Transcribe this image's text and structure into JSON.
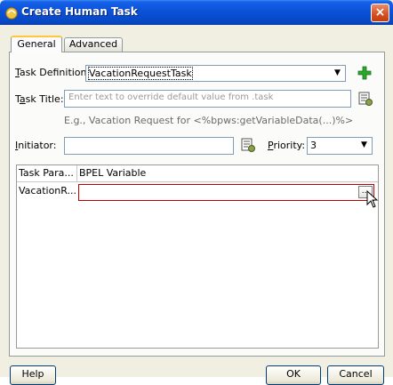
{
  "window": {
    "title": "Create Human Task",
    "close_label": "×"
  },
  "tabs": [
    {
      "label": "General",
      "active": true
    },
    {
      "label": "Advanced",
      "active": false
    }
  ],
  "task_definition": {
    "label_prefix": "",
    "label_mnemonic": "T",
    "label_rest": "ask Definition:",
    "value": "VacationRequestTask"
  },
  "task_title": {
    "label_prefix": "T",
    "label_mnemonic": "a",
    "label_rest": "sk Title:",
    "placeholder": "Enter text to override default value from .task",
    "hint": "E.g., Vacation Request for <%bpws:getVariableData(...)%>"
  },
  "initiator": {
    "label_prefix": "",
    "label_mnemonic": "I",
    "label_rest": "nitiator:",
    "value": ""
  },
  "priority": {
    "label_prefix": "",
    "label_mnemonic": "P",
    "label_rest": "riority:",
    "value": "3"
  },
  "parameters_table": {
    "columns": [
      "Task Para...",
      "BPEL Variable"
    ],
    "rows": [
      {
        "param": "VacationR...",
        "variable": ""
      }
    ],
    "browse_label": "..."
  },
  "buttons": {
    "help": "Help",
    "ok": "OK",
    "cancel": "Cancel"
  },
  "colors": {
    "titlebar": "#0a50d6",
    "editor_border": "#c00000",
    "tab_highlight": "#ffc83c",
    "dialog_bg": "#f1efe2"
  },
  "icons": {
    "title": "oracle-task-icon",
    "add": "green-plus-icon",
    "expression": "xpath-expression-icon"
  }
}
